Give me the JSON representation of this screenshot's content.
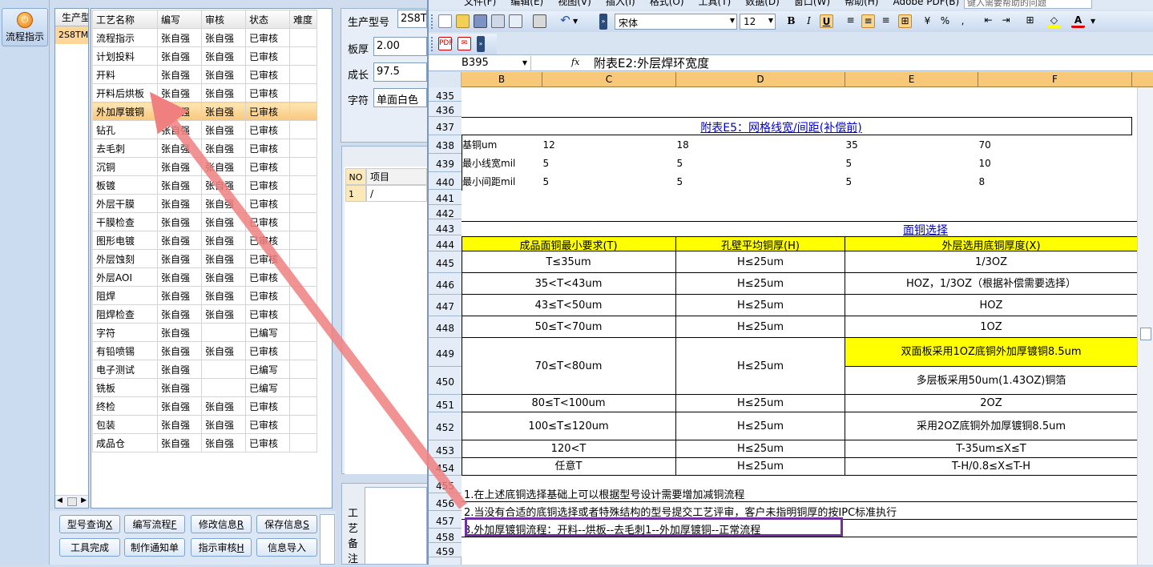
{
  "left_app": {
    "process_button": "流程指示",
    "model_list": {
      "header": "生产型",
      "selected": "2S8TM"
    },
    "process_table": {
      "columns": [
        "工艺名称",
        "编写",
        "审核",
        "状态",
        "难度"
      ],
      "rows": [
        [
          "流程指示",
          "张自强",
          "张自强",
          "已审核",
          ""
        ],
        [
          "计划投料",
          "张自强",
          "张自强",
          "已审核",
          ""
        ],
        [
          "开料",
          "张自强",
          "张自强",
          "已审核",
          ""
        ],
        [
          "开料后烘板",
          "张自强",
          "张自强",
          "已审核",
          ""
        ],
        [
          "外加厚镀铜",
          "张自强",
          "张自强",
          "已审核",
          ""
        ],
        [
          "钻孔",
          "张自强",
          "张自强",
          "已审核",
          ""
        ],
        [
          "去毛刺",
          "张自强",
          "张自强",
          "已审核",
          ""
        ],
        [
          "沉铜",
          "张自强",
          "张自强",
          "已审核",
          ""
        ],
        [
          "板镀",
          "张自强",
          "张自强",
          "已审核",
          ""
        ],
        [
          "外层干膜",
          "张自强",
          "张自强",
          "已审核",
          ""
        ],
        [
          "干膜检查",
          "张自强",
          "张自强",
          "已审核",
          ""
        ],
        [
          "图形电镀",
          "张自强",
          "张自强",
          "已审核",
          ""
        ],
        [
          "外层蚀刻",
          "张自强",
          "张自强",
          "已审核",
          ""
        ],
        [
          "外层AOI",
          "张自强",
          "张自强",
          "已审核",
          ""
        ],
        [
          "阻焊",
          "张自强",
          "张自强",
          "已审核",
          ""
        ],
        [
          "阻焊检查",
          "张自强",
          "张自强",
          "已审核",
          ""
        ],
        [
          "字符",
          "张自强",
          "",
          "已编写",
          ""
        ],
        [
          "有铅喷锡",
          "张自强",
          "张自强",
          "已审核",
          ""
        ],
        [
          "电子测试",
          "张自强",
          "",
          "已编写",
          ""
        ],
        [
          "铣板",
          "张自强",
          "",
          "已编写",
          ""
        ],
        [
          "终检",
          "张自强",
          "张自强",
          "已审核",
          ""
        ],
        [
          "包装",
          "张自强",
          "张自强",
          "已审核",
          ""
        ],
        [
          "成品仓",
          "张自强",
          "张自强",
          "已审核",
          ""
        ]
      ],
      "selected_row": "外加厚镀铜"
    },
    "info": {
      "model_label": "生产型号",
      "model_value": "2S8T",
      "thickness_label": "板厚",
      "thickness_value": "2.00",
      "length_label": "成长",
      "length_value": "97.5",
      "char_label": "字符",
      "char_value": "单面白色"
    },
    "items_grid": {
      "col_no": "NO",
      "col_item": "项目",
      "row_no": "1",
      "row_item": "/"
    },
    "remark_label": [
      "工",
      "艺",
      "备",
      "注"
    ],
    "buttons_row1": [
      {
        "label": "型号查询",
        "key": "X"
      },
      {
        "label": "编写流程",
        "key": "F"
      },
      {
        "label": "修改信息",
        "key": "R"
      },
      {
        "label": "保存信息",
        "key": "S"
      }
    ],
    "buttons_row2": [
      {
        "label": "工具完成",
        "key": ""
      },
      {
        "label": "制作通知单",
        "key": ""
      },
      {
        "label": "指示审核",
        "key": "H"
      },
      {
        "label": "信息导入",
        "key": ""
      }
    ]
  },
  "excel": {
    "menu": [
      "文件(F)",
      "编辑(E)",
      "视图(V)",
      "插入(I)",
      "格式(O)",
      "工具(T)",
      "数据(D)",
      "窗口(W)",
      "帮助(H)",
      "Adobe PDF(B)"
    ],
    "help_placeholder": "键入需要帮助的问题",
    "font_name": "宋体",
    "font_size": "12",
    "name_box": "B395",
    "fx": "fx",
    "formula": "附表E2:外层焊环宽度",
    "col_headers": [
      "B",
      "C",
      "D",
      "E",
      "F"
    ],
    "row_numbers": [
      "435",
      "436",
      "437",
      "438",
      "439",
      "440",
      "441",
      "442",
      "443",
      "444",
      "445",
      "446",
      "447",
      "448",
      "449",
      "450",
      "451",
      "452",
      "453",
      "454",
      "455",
      "456",
      "457",
      "458",
      "459"
    ],
    "table_e5": {
      "title": "附表E5：网格线宽/间距(补偿前)",
      "header": [
        "基铜um",
        "12",
        "18",
        "35",
        "70"
      ],
      "rows": [
        [
          "最小线宽mil",
          "5",
          "5",
          "5",
          "10"
        ],
        [
          "最小间距mil",
          "5",
          "5",
          "5",
          "8"
        ]
      ]
    },
    "copper": {
      "title": "面铜选择",
      "header": [
        "成品面铜最小要求(T)",
        "孔壁平均铜厚(H)",
        "外层选用底铜厚度(X)"
      ],
      "rows": [
        [
          "T≤35um",
          "H≤25um",
          "1/3OZ"
        ],
        [
          "35<T<43um",
          "H≤25um",
          "HOZ，1/3OZ（根据补偿需要选择）"
        ],
        [
          "43≤T<50um",
          "H≤25um",
          "HOZ"
        ],
        [
          "50≤T<70um",
          "H≤25um",
          "1OZ"
        ],
        [
          "70≤T<80um",
          "H≤25um",
          "双面板采用1OZ底铜外加厚镀铜8.5um",
          "多层板采用50um(1.43OZ)铜箔"
        ],
        [
          "80≤T<100um",
          "H≤25um",
          "2OZ"
        ],
        [
          "100≤T≤120um",
          "H≤25um",
          "采用2OZ底铜外加厚镀铜8.5um"
        ],
        [
          "120<T",
          "H≤25um",
          "T-35um≤X≤T"
        ],
        [
          "任意T",
          "H≤25um",
          "T-H/0.8≤X≤T-H"
        ]
      ]
    },
    "notes": [
      "1.在上述底铜选择基础上可以根据型号设计需要增加减铜流程",
      "2.当没有合适的底铜选择或者特殊结构的型号提交工艺评审，客户未指明铜厚的按IPC标准执行",
      "3.外加厚镀铜流程：开料--烘板--去毛刺1--外加厚镀铜--正常流程"
    ]
  },
  "colors": {
    "arrow": "#f08080",
    "highlight_box": "#7030a0",
    "yellow": "#ffff00",
    "link": "#0000cc"
  }
}
